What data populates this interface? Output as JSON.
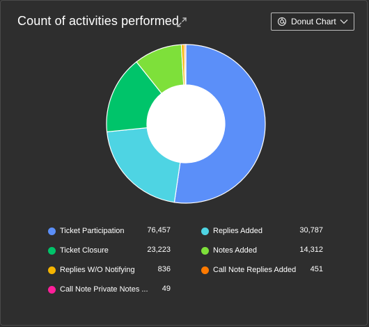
{
  "header": {
    "title": "Count of activities performed",
    "chart_type_label": "Donut Chart"
  },
  "icons": {
    "expand": "expand-icon",
    "chart_type": "donut-chart-icon",
    "dropdown": "chevron-down-icon"
  },
  "chart_data": {
    "type": "pie",
    "variant": "donut",
    "title": "Count of activities performed",
    "categories": [
      "Ticket Participation",
      "Replies Added",
      "Ticket Closure",
      "Notes Added",
      "Replies W/O Notifying",
      "Call Note Replies Added",
      "Call Note Private Notes ..."
    ],
    "values": [
      76457,
      30787,
      23223,
      14312,
      836,
      451,
      49
    ],
    "value_labels": [
      "76,457",
      "30,787",
      "23,223",
      "14,312",
      "836",
      "451",
      "49"
    ],
    "colors": [
      "#5b8ff9",
      "#4ed4e3",
      "#00c46a",
      "#7ee03a",
      "#f5b400",
      "#ff7a00",
      "#ff1f9a"
    ],
    "legend_position": "bottom"
  }
}
